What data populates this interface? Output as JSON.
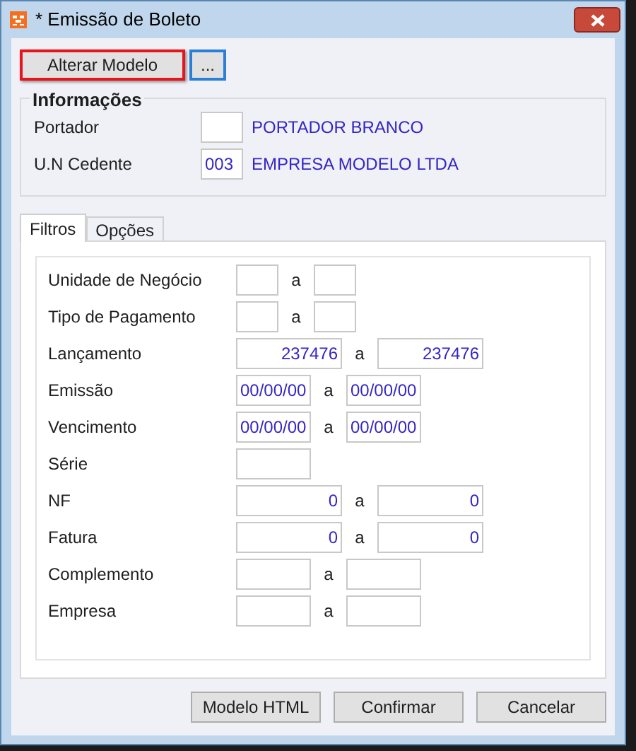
{
  "window": {
    "title": "* Emissão de Boleto"
  },
  "toolbar": [
    {
      "label": "Alterar Modelo",
      "highlighted": true
    },
    {
      "label": "...",
      "highlighted": false,
      "focused": true
    }
  ],
  "informacoes": {
    "title": "Informações",
    "rows": [
      {
        "label": "Portador",
        "description": "PORTADOR BRANCO"
      },
      {
        "label": "U.N Cedente",
        "code": "003",
        "description": "EMPRESA MODELO LTDA"
      }
    ]
  },
  "tabs": [
    {
      "label": "Filtros",
      "selected": true
    },
    {
      "label": "Opções",
      "selected": false
    }
  ],
  "filters": [
    {
      "label": "Unidade de Negócio",
      "kind": "code",
      "separator": "a"
    },
    {
      "label": "Tipo de Pagamento",
      "kind": "code",
      "separator": "a"
    },
    {
      "label": "Lançamento",
      "kind": "number",
      "from": "237476",
      "separator": "a",
      "to": "237476"
    },
    {
      "label": "Emissão",
      "kind": "date",
      "from": "00/00/00",
      "separator": "a",
      "to": "00/00/00"
    },
    {
      "label": "Vencimento",
      "kind": "date",
      "from": "00/00/00",
      "separator": "a",
      "to": "00/00/00"
    },
    {
      "label": "Série",
      "kind": "single"
    },
    {
      "label": "NF",
      "kind": "number",
      "from": "0",
      "separator": "a",
      "to": "0"
    },
    {
      "label": "Fatura",
      "kind": "number",
      "from": "0",
      "separator": "a",
      "to": "0"
    },
    {
      "label": "Complemento",
      "kind": "text",
      "separator": "a"
    },
    {
      "label": "Empresa",
      "kind": "text",
      "separator": "a"
    }
  ],
  "buttons": [
    "Modelo HTML",
    "Confirmar",
    "Cancelar"
  ]
}
